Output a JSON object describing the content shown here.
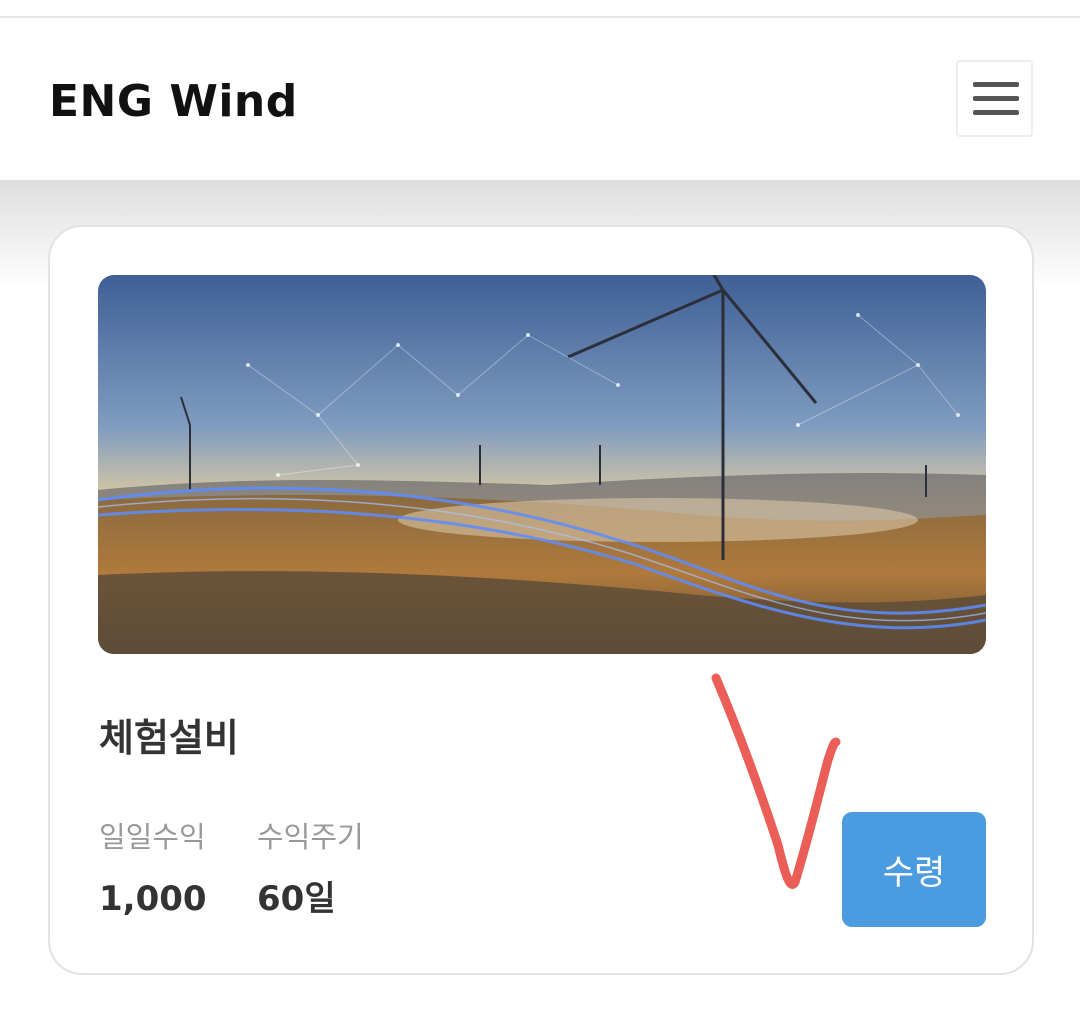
{
  "header": {
    "brand": "ENG Wind",
    "menu_icon": "hamburger-menu-icon"
  },
  "card": {
    "image_alt": "wind turbines landscape",
    "product_name": "체험설비",
    "stats": [
      {
        "label": "일일수익",
        "value": "1,000"
      },
      {
        "label": "수익주기",
        "value": "60일"
      }
    ],
    "claim_label": "수령"
  },
  "colors": {
    "accent": "#4a9be0",
    "annotation_mark": "#e8413a"
  }
}
